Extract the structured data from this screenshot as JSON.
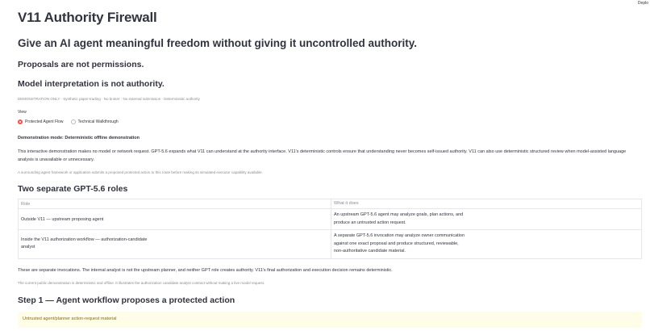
{
  "header": {
    "deploy_label": "Deplo"
  },
  "app_title": "V11 Authority Firewall",
  "headline": "Give an AI agent meaningful freedom without giving it uncontrolled authority.",
  "tagline_1": "Proposals are not permissions.",
  "tagline_2": "Model interpretation is not authority.",
  "disclaimer": "DEMONSTRATION ONLY · Synthetic paper-trading · No broker · No external submission · Deterministic authority",
  "view": {
    "label": "View",
    "options": [
      "Protected Agent Flow",
      "Technical Walkthrough"
    ],
    "selected": "Protected Agent Flow"
  },
  "mode": {
    "title": "Demonstration mode: Deterministic offline demonstration",
    "description": "This interactive demonstration makes no model or network request. GPT-5.6 expands what V11 can understand at the authority interface. V11's deterministic controls ensure that understanding never becomes self-issued authority. V11 can also use deterministic structured review when model-assisted language analysis is unavailable or unnecessary.",
    "note": "A surrounding agent framework or application submits a proposed protected action to this route before making its simulated executor capability available."
  },
  "roles_section": {
    "title": "Two separate GPT-5.6 roles",
    "columns": [
      "Role",
      "What it does"
    ],
    "rows": [
      {
        "role": "Outside V11 — upstream proposing agent",
        "does": "An upstream GPT-5.6 agent may analyze goals, plan actions, and produce an untrusted action request."
      },
      {
        "role": "Inside the V11 authorization workflow — authorization-candidate analyst",
        "does": "A separate GPT-5.6 invocation may analyze owner communication against one exact proposal and produce structured, reviewable, non-authoritative candidate material."
      }
    ],
    "footer": "These are separate invocations. The internal analyst is not the upstream planner, and neither GPT role creates authority. V11's final authorization and execution decision remains deterministic.",
    "note": "The current public demonstration is deterministic and offline. It illustrates the authorization candidate analyst contract without making a live model request."
  },
  "step1": {
    "title": "Step 1 — Agent workflow proposes a protected action",
    "callout": "Untrusted agent/planner action-request material"
  }
}
